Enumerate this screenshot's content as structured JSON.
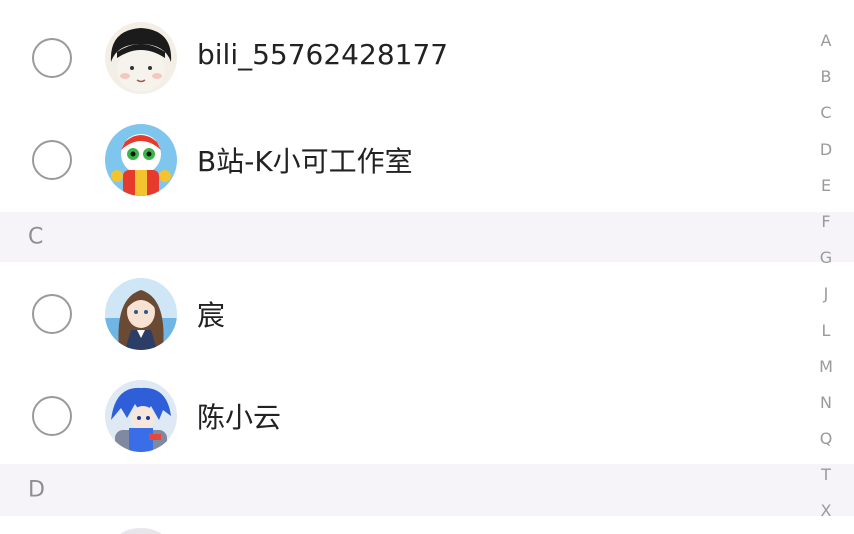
{
  "contacts": [
    {
      "name": "bili_55762428177",
      "avatar": "boy-cartoon-avatar"
    },
    {
      "name": "B站-K小可工作室",
      "avatar": "mascot-cartoon-avatar"
    }
  ],
  "sections": [
    {
      "letter": "C",
      "contacts": [
        {
          "name": "宸",
          "avatar": "anime-girl-avatar"
        },
        {
          "name": "陈小云",
          "avatar": "blue-hair-anime-avatar"
        }
      ]
    },
    {
      "letter": "D",
      "contacts": []
    }
  ],
  "index_bar": [
    "A",
    "B",
    "C",
    "D",
    "E",
    "F",
    "G",
    "J",
    "L",
    "M",
    "N",
    "Q",
    "T",
    "X"
  ],
  "colors": {
    "section_bg": "#f6f4f8",
    "row_bg": "#ffffff",
    "radio_border": "#9a9a9e",
    "name_text": "#222222",
    "index_text": "#9a9a9e"
  }
}
